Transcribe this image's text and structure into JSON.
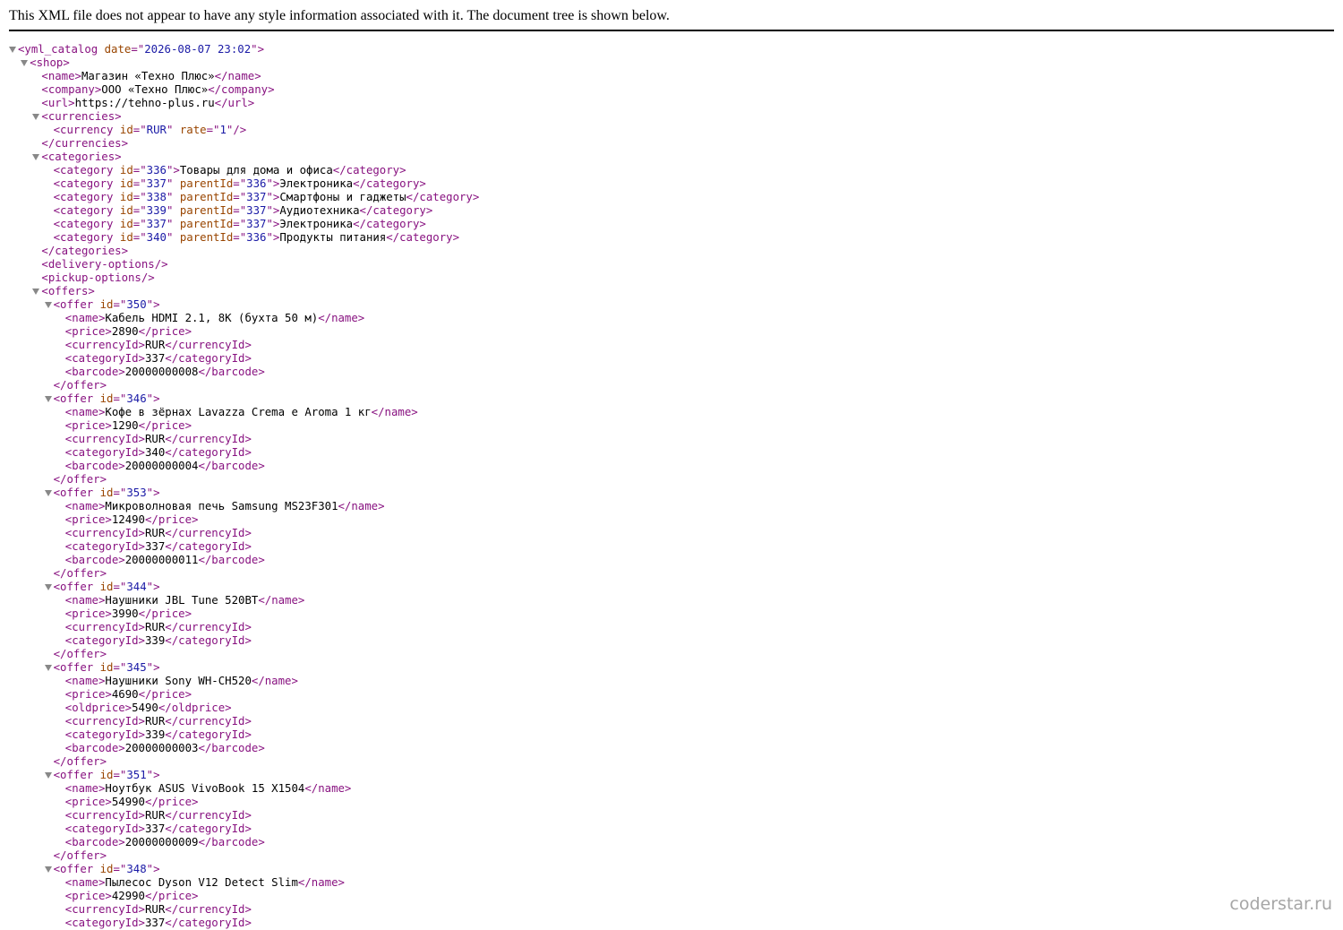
{
  "header": {
    "notice": "This XML file does not appear to have any style information associated with it. The document tree is shown below."
  },
  "watermark": "coderstar.ru",
  "colors": {
    "tag": "#881280",
    "attr_name": "#994500",
    "attr_value": "#1a1aa6",
    "text": "#000000"
  },
  "lines": [
    {
      "d": 0,
      "t": 1,
      "p": [
        [
          "tag",
          "<yml_catalog"
        ],
        [
          "tx",
          " "
        ],
        [
          "an",
          "date"
        ],
        [
          "tag",
          "=\""
        ],
        [
          "av",
          "2026-08-07 23:02"
        ],
        [
          "tag",
          "\">"
        ]
      ]
    },
    {
      "d": 1,
      "t": 1,
      "p": [
        [
          "tag",
          "<shop>"
        ]
      ]
    },
    {
      "d": 2,
      "t": 0,
      "p": [
        [
          "tag",
          "<name>"
        ],
        [
          "tx",
          "Магазин «Техно Плюс»"
        ],
        [
          "tag",
          "</name>"
        ]
      ]
    },
    {
      "d": 2,
      "t": 0,
      "p": [
        [
          "tag",
          "<company>"
        ],
        [
          "tx",
          "ООО «Техно Плюс»"
        ],
        [
          "tag",
          "</company>"
        ]
      ]
    },
    {
      "d": 2,
      "t": 0,
      "p": [
        [
          "tag",
          "<url>"
        ],
        [
          "tx",
          "https://tehno-plus.ru"
        ],
        [
          "tag",
          "</url>"
        ]
      ]
    },
    {
      "d": 2,
      "t": 1,
      "p": [
        [
          "tag",
          "<currencies>"
        ]
      ]
    },
    {
      "d": 3,
      "t": 0,
      "p": [
        [
          "tag",
          "<currency"
        ],
        [
          "tx",
          " "
        ],
        [
          "an",
          "id"
        ],
        [
          "tag",
          "=\""
        ],
        [
          "av",
          "RUR"
        ],
        [
          "tag",
          "\""
        ],
        [
          "tx",
          " "
        ],
        [
          "an",
          "rate"
        ],
        [
          "tag",
          "=\""
        ],
        [
          "av",
          "1"
        ],
        [
          "tag",
          "\"/>"
        ]
      ]
    },
    {
      "d": 2,
      "t": 0,
      "p": [
        [
          "tag",
          "</currencies>"
        ]
      ]
    },
    {
      "d": 2,
      "t": 1,
      "p": [
        [
          "tag",
          "<categories>"
        ]
      ]
    },
    {
      "d": 3,
      "t": 0,
      "p": [
        [
          "tag",
          "<category"
        ],
        [
          "tx",
          " "
        ],
        [
          "an",
          "id"
        ],
        [
          "tag",
          "=\""
        ],
        [
          "av",
          "336"
        ],
        [
          "tag",
          "\">"
        ],
        [
          "tx",
          "Товары для дома и офиса"
        ],
        [
          "tag",
          "</category>"
        ]
      ]
    },
    {
      "d": 3,
      "t": 0,
      "p": [
        [
          "tag",
          "<category"
        ],
        [
          "tx",
          " "
        ],
        [
          "an",
          "id"
        ],
        [
          "tag",
          "=\""
        ],
        [
          "av",
          "337"
        ],
        [
          "tag",
          "\""
        ],
        [
          "tx",
          " "
        ],
        [
          "an",
          "parentId"
        ],
        [
          "tag",
          "=\""
        ],
        [
          "av",
          "336"
        ],
        [
          "tag",
          "\">"
        ],
        [
          "tx",
          "Электроника"
        ],
        [
          "tag",
          "</category>"
        ]
      ]
    },
    {
      "d": 3,
      "t": 0,
      "p": [
        [
          "tag",
          "<category"
        ],
        [
          "tx",
          " "
        ],
        [
          "an",
          "id"
        ],
        [
          "tag",
          "=\""
        ],
        [
          "av",
          "338"
        ],
        [
          "tag",
          "\""
        ],
        [
          "tx",
          " "
        ],
        [
          "an",
          "parentId"
        ],
        [
          "tag",
          "=\""
        ],
        [
          "av",
          "337"
        ],
        [
          "tag",
          "\">"
        ],
        [
          "tx",
          "Смартфоны и гаджеты"
        ],
        [
          "tag",
          "</category>"
        ]
      ]
    },
    {
      "d": 3,
      "t": 0,
      "p": [
        [
          "tag",
          "<category"
        ],
        [
          "tx",
          " "
        ],
        [
          "an",
          "id"
        ],
        [
          "tag",
          "=\""
        ],
        [
          "av",
          "339"
        ],
        [
          "tag",
          "\""
        ],
        [
          "tx",
          " "
        ],
        [
          "an",
          "parentId"
        ],
        [
          "tag",
          "=\""
        ],
        [
          "av",
          "337"
        ],
        [
          "tag",
          "\">"
        ],
        [
          "tx",
          "Аудиотехника"
        ],
        [
          "tag",
          "</category>"
        ]
      ]
    },
    {
      "d": 3,
      "t": 0,
      "p": [
        [
          "tag",
          "<category"
        ],
        [
          "tx",
          " "
        ],
        [
          "an",
          "id"
        ],
        [
          "tag",
          "=\""
        ],
        [
          "av",
          "337"
        ],
        [
          "tag",
          "\""
        ],
        [
          "tx",
          " "
        ],
        [
          "an",
          "parentId"
        ],
        [
          "tag",
          "=\""
        ],
        [
          "av",
          "337"
        ],
        [
          "tag",
          "\">"
        ],
        [
          "tx",
          "Электроника"
        ],
        [
          "tag",
          "</category>"
        ]
      ]
    },
    {
      "d": 3,
      "t": 0,
      "p": [
        [
          "tag",
          "<category"
        ],
        [
          "tx",
          " "
        ],
        [
          "an",
          "id"
        ],
        [
          "tag",
          "=\""
        ],
        [
          "av",
          "340"
        ],
        [
          "tag",
          "\""
        ],
        [
          "tx",
          " "
        ],
        [
          "an",
          "parentId"
        ],
        [
          "tag",
          "=\""
        ],
        [
          "av",
          "336"
        ],
        [
          "tag",
          "\">"
        ],
        [
          "tx",
          "Продукты питания"
        ],
        [
          "tag",
          "</category>"
        ]
      ]
    },
    {
      "d": 2,
      "t": 0,
      "p": [
        [
          "tag",
          "</categories>"
        ]
      ]
    },
    {
      "d": 2,
      "t": 0,
      "p": [
        [
          "tag",
          "<delivery-options/>"
        ]
      ]
    },
    {
      "d": 2,
      "t": 0,
      "p": [
        [
          "tag",
          "<pickup-options/>"
        ]
      ]
    },
    {
      "d": 2,
      "t": 1,
      "p": [
        [
          "tag",
          "<offers>"
        ]
      ]
    },
    {
      "d": 3,
      "t": 1,
      "p": [
        [
          "tag",
          "<offer"
        ],
        [
          "tx",
          " "
        ],
        [
          "an",
          "id"
        ],
        [
          "tag",
          "=\""
        ],
        [
          "av",
          "350"
        ],
        [
          "tag",
          "\">"
        ]
      ]
    },
    {
      "d": 4,
      "t": 0,
      "p": [
        [
          "tag",
          "<name>"
        ],
        [
          "tx",
          "Кабель HDMI 2.1, 8K (бухта 50 м)"
        ],
        [
          "tag",
          "</name>"
        ]
      ]
    },
    {
      "d": 4,
      "t": 0,
      "p": [
        [
          "tag",
          "<price>"
        ],
        [
          "tx",
          "2890"
        ],
        [
          "tag",
          "</price>"
        ]
      ]
    },
    {
      "d": 4,
      "t": 0,
      "p": [
        [
          "tag",
          "<currencyId>"
        ],
        [
          "tx",
          "RUR"
        ],
        [
          "tag",
          "</currencyId>"
        ]
      ]
    },
    {
      "d": 4,
      "t": 0,
      "p": [
        [
          "tag",
          "<categoryId>"
        ],
        [
          "tx",
          "337"
        ],
        [
          "tag",
          "</categoryId>"
        ]
      ]
    },
    {
      "d": 4,
      "t": 0,
      "p": [
        [
          "tag",
          "<barcode>"
        ],
        [
          "tx",
          "20000000008"
        ],
        [
          "tag",
          "</barcode>"
        ]
      ]
    },
    {
      "d": 3,
      "t": 0,
      "p": [
        [
          "tag",
          "</offer>"
        ]
      ]
    },
    {
      "d": 3,
      "t": 1,
      "p": [
        [
          "tag",
          "<offer"
        ],
        [
          "tx",
          " "
        ],
        [
          "an",
          "id"
        ],
        [
          "tag",
          "=\""
        ],
        [
          "av",
          "346"
        ],
        [
          "tag",
          "\">"
        ]
      ]
    },
    {
      "d": 4,
      "t": 0,
      "p": [
        [
          "tag",
          "<name>"
        ],
        [
          "tx",
          "Кофе в зёрнах Lavazza Crema e Aroma 1 кг"
        ],
        [
          "tag",
          "</name>"
        ]
      ]
    },
    {
      "d": 4,
      "t": 0,
      "p": [
        [
          "tag",
          "<price>"
        ],
        [
          "tx",
          "1290"
        ],
        [
          "tag",
          "</price>"
        ]
      ]
    },
    {
      "d": 4,
      "t": 0,
      "p": [
        [
          "tag",
          "<currencyId>"
        ],
        [
          "tx",
          "RUR"
        ],
        [
          "tag",
          "</currencyId>"
        ]
      ]
    },
    {
      "d": 4,
      "t": 0,
      "p": [
        [
          "tag",
          "<categoryId>"
        ],
        [
          "tx",
          "340"
        ],
        [
          "tag",
          "</categoryId>"
        ]
      ]
    },
    {
      "d": 4,
      "t": 0,
      "p": [
        [
          "tag",
          "<barcode>"
        ],
        [
          "tx",
          "20000000004"
        ],
        [
          "tag",
          "</barcode>"
        ]
      ]
    },
    {
      "d": 3,
      "t": 0,
      "p": [
        [
          "tag",
          "</offer>"
        ]
      ]
    },
    {
      "d": 3,
      "t": 1,
      "p": [
        [
          "tag",
          "<offer"
        ],
        [
          "tx",
          " "
        ],
        [
          "an",
          "id"
        ],
        [
          "tag",
          "=\""
        ],
        [
          "av",
          "353"
        ],
        [
          "tag",
          "\">"
        ]
      ]
    },
    {
      "d": 4,
      "t": 0,
      "p": [
        [
          "tag",
          "<name>"
        ],
        [
          "tx",
          "Микроволновая печь Samsung MS23F301"
        ],
        [
          "tag",
          "</name>"
        ]
      ]
    },
    {
      "d": 4,
      "t": 0,
      "p": [
        [
          "tag",
          "<price>"
        ],
        [
          "tx",
          "12490"
        ],
        [
          "tag",
          "</price>"
        ]
      ]
    },
    {
      "d": 4,
      "t": 0,
      "p": [
        [
          "tag",
          "<currencyId>"
        ],
        [
          "tx",
          "RUR"
        ],
        [
          "tag",
          "</currencyId>"
        ]
      ]
    },
    {
      "d": 4,
      "t": 0,
      "p": [
        [
          "tag",
          "<categoryId>"
        ],
        [
          "tx",
          "337"
        ],
        [
          "tag",
          "</categoryId>"
        ]
      ]
    },
    {
      "d": 4,
      "t": 0,
      "p": [
        [
          "tag",
          "<barcode>"
        ],
        [
          "tx",
          "20000000011"
        ],
        [
          "tag",
          "</barcode>"
        ]
      ]
    },
    {
      "d": 3,
      "t": 0,
      "p": [
        [
          "tag",
          "</offer>"
        ]
      ]
    },
    {
      "d": 3,
      "t": 1,
      "p": [
        [
          "tag",
          "<offer"
        ],
        [
          "tx",
          " "
        ],
        [
          "an",
          "id"
        ],
        [
          "tag",
          "=\""
        ],
        [
          "av",
          "344"
        ],
        [
          "tag",
          "\">"
        ]
      ]
    },
    {
      "d": 4,
      "t": 0,
      "p": [
        [
          "tag",
          "<name>"
        ],
        [
          "tx",
          "Наушники JBL Tune 520BT"
        ],
        [
          "tag",
          "</name>"
        ]
      ]
    },
    {
      "d": 4,
      "t": 0,
      "p": [
        [
          "tag",
          "<price>"
        ],
        [
          "tx",
          "3990"
        ],
        [
          "tag",
          "</price>"
        ]
      ]
    },
    {
      "d": 4,
      "t": 0,
      "p": [
        [
          "tag",
          "<currencyId>"
        ],
        [
          "tx",
          "RUR"
        ],
        [
          "tag",
          "</currencyId>"
        ]
      ]
    },
    {
      "d": 4,
      "t": 0,
      "p": [
        [
          "tag",
          "<categoryId>"
        ],
        [
          "tx",
          "339"
        ],
        [
          "tag",
          "</categoryId>"
        ]
      ]
    },
    {
      "d": 3,
      "t": 0,
      "p": [
        [
          "tag",
          "</offer>"
        ]
      ]
    },
    {
      "d": 3,
      "t": 1,
      "p": [
        [
          "tag",
          "<offer"
        ],
        [
          "tx",
          " "
        ],
        [
          "an",
          "id"
        ],
        [
          "tag",
          "=\""
        ],
        [
          "av",
          "345"
        ],
        [
          "tag",
          "\">"
        ]
      ]
    },
    {
      "d": 4,
      "t": 0,
      "p": [
        [
          "tag",
          "<name>"
        ],
        [
          "tx",
          "Наушники Sony WH-CH520"
        ],
        [
          "tag",
          "</name>"
        ]
      ]
    },
    {
      "d": 4,
      "t": 0,
      "p": [
        [
          "tag",
          "<price>"
        ],
        [
          "tx",
          "4690"
        ],
        [
          "tag",
          "</price>"
        ]
      ]
    },
    {
      "d": 4,
      "t": 0,
      "p": [
        [
          "tag",
          "<oldprice>"
        ],
        [
          "tx",
          "5490"
        ],
        [
          "tag",
          "</oldprice>"
        ]
      ]
    },
    {
      "d": 4,
      "t": 0,
      "p": [
        [
          "tag",
          "<currencyId>"
        ],
        [
          "tx",
          "RUR"
        ],
        [
          "tag",
          "</currencyId>"
        ]
      ]
    },
    {
      "d": 4,
      "t": 0,
      "p": [
        [
          "tag",
          "<categoryId>"
        ],
        [
          "tx",
          "339"
        ],
        [
          "tag",
          "</categoryId>"
        ]
      ]
    },
    {
      "d": 4,
      "t": 0,
      "p": [
        [
          "tag",
          "<barcode>"
        ],
        [
          "tx",
          "20000000003"
        ],
        [
          "tag",
          "</barcode>"
        ]
      ]
    },
    {
      "d": 3,
      "t": 0,
      "p": [
        [
          "tag",
          "</offer>"
        ]
      ]
    },
    {
      "d": 3,
      "t": 1,
      "p": [
        [
          "tag",
          "<offer"
        ],
        [
          "tx",
          " "
        ],
        [
          "an",
          "id"
        ],
        [
          "tag",
          "=\""
        ],
        [
          "av",
          "351"
        ],
        [
          "tag",
          "\">"
        ]
      ]
    },
    {
      "d": 4,
      "t": 0,
      "p": [
        [
          "tag",
          "<name>"
        ],
        [
          "tx",
          "Ноутбук ASUS VivoBook 15 X1504"
        ],
        [
          "tag",
          "</name>"
        ]
      ]
    },
    {
      "d": 4,
      "t": 0,
      "p": [
        [
          "tag",
          "<price>"
        ],
        [
          "tx",
          "54990"
        ],
        [
          "tag",
          "</price>"
        ]
      ]
    },
    {
      "d": 4,
      "t": 0,
      "p": [
        [
          "tag",
          "<currencyId>"
        ],
        [
          "tx",
          "RUR"
        ],
        [
          "tag",
          "</currencyId>"
        ]
      ]
    },
    {
      "d": 4,
      "t": 0,
      "p": [
        [
          "tag",
          "<categoryId>"
        ],
        [
          "tx",
          "337"
        ],
        [
          "tag",
          "</categoryId>"
        ]
      ]
    },
    {
      "d": 4,
      "t": 0,
      "p": [
        [
          "tag",
          "<barcode>"
        ],
        [
          "tx",
          "20000000009"
        ],
        [
          "tag",
          "</barcode>"
        ]
      ]
    },
    {
      "d": 3,
      "t": 0,
      "p": [
        [
          "tag",
          "</offer>"
        ]
      ]
    },
    {
      "d": 3,
      "t": 1,
      "p": [
        [
          "tag",
          "<offer"
        ],
        [
          "tx",
          " "
        ],
        [
          "an",
          "id"
        ],
        [
          "tag",
          "=\""
        ],
        [
          "av",
          "348"
        ],
        [
          "tag",
          "\">"
        ]
      ]
    },
    {
      "d": 4,
      "t": 0,
      "p": [
        [
          "tag",
          "<name>"
        ],
        [
          "tx",
          "Пылесос Dyson V12 Detect Slim"
        ],
        [
          "tag",
          "</name>"
        ]
      ]
    },
    {
      "d": 4,
      "t": 0,
      "p": [
        [
          "tag",
          "<price>"
        ],
        [
          "tx",
          "42990"
        ],
        [
          "tag",
          "</price>"
        ]
      ]
    },
    {
      "d": 4,
      "t": 0,
      "p": [
        [
          "tag",
          "<currencyId>"
        ],
        [
          "tx",
          "RUR"
        ],
        [
          "tag",
          "</currencyId>"
        ]
      ]
    },
    {
      "d": 4,
      "t": 0,
      "p": [
        [
          "tag",
          "<categoryId>"
        ],
        [
          "tx",
          "337"
        ],
        [
          "tag",
          "</categoryId>"
        ]
      ]
    }
  ]
}
